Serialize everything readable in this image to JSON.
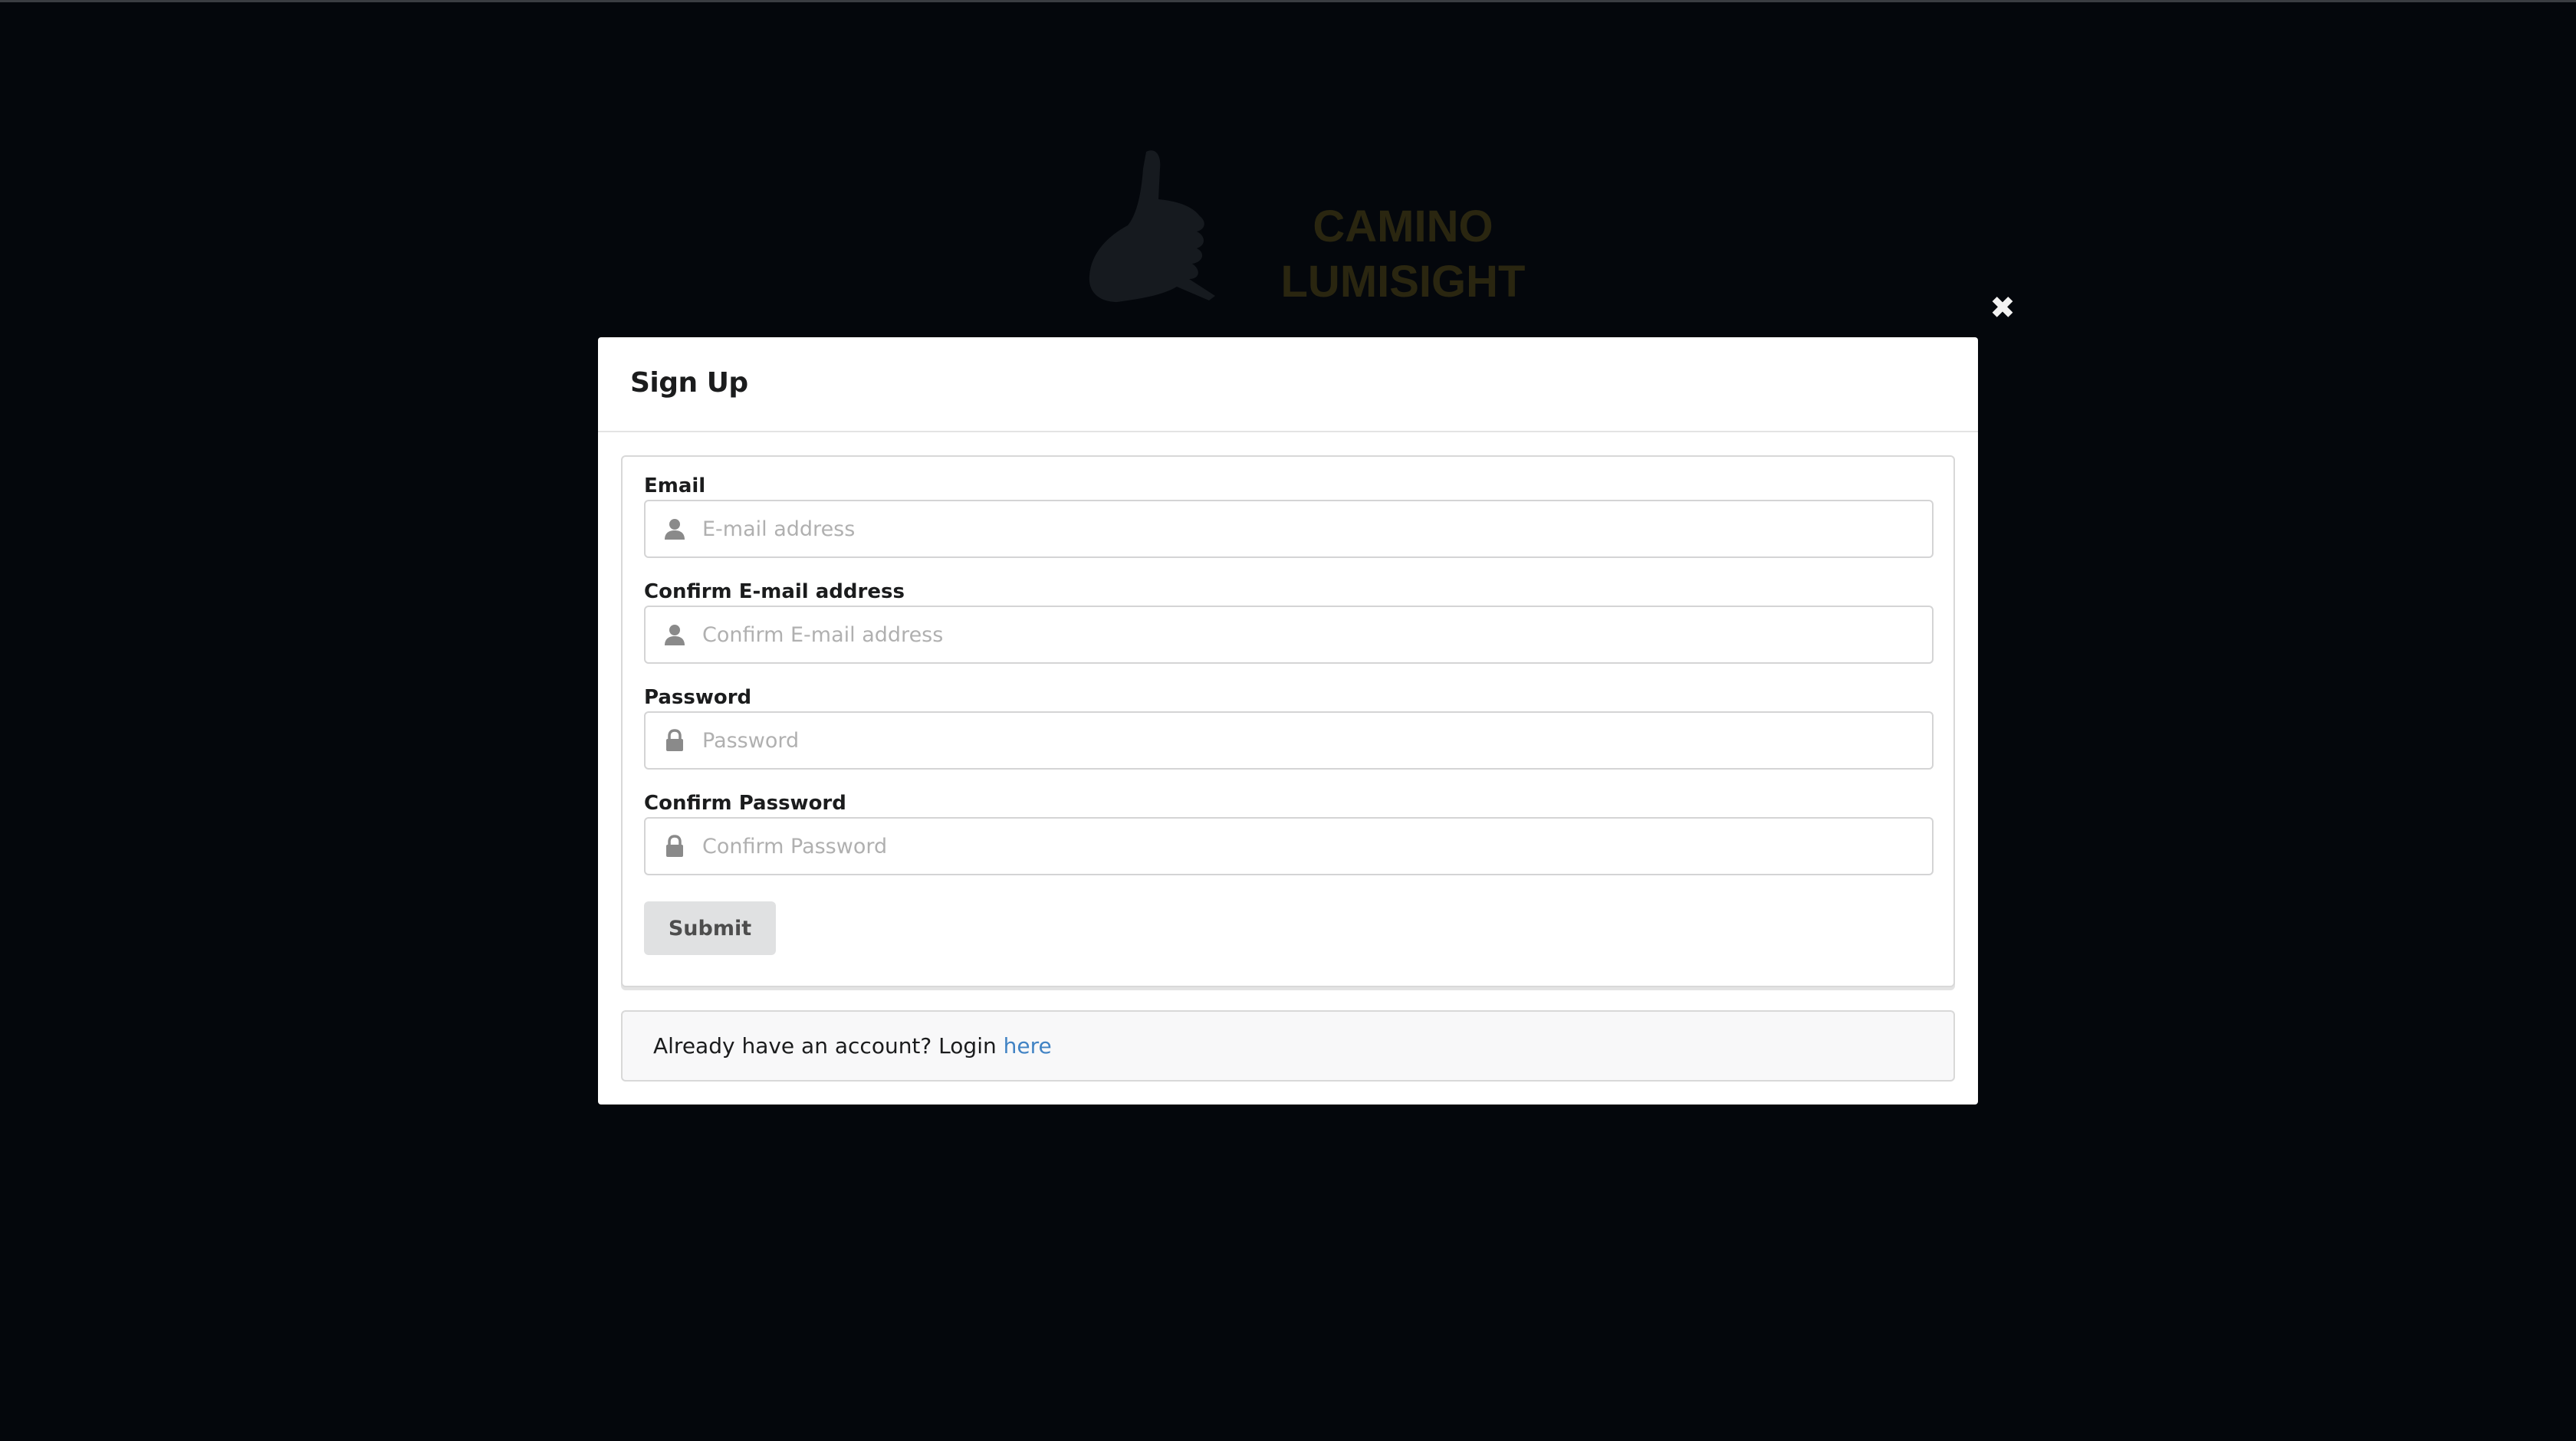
{
  "brand": {
    "line1": "CAMINO",
    "line2": "LUMISIGHT"
  },
  "modal": {
    "title": "Sign Up",
    "close_icon": "close-icon"
  },
  "form": {
    "fields": [
      {
        "label": "Email",
        "placeholder": "E-mail address",
        "value": "",
        "icon": "user-icon",
        "type": "text"
      },
      {
        "label": "Confirm E-mail address",
        "placeholder": "Confirm E-mail address",
        "value": "",
        "icon": "user-icon",
        "type": "text"
      },
      {
        "label": "Password",
        "placeholder": "Password",
        "value": "",
        "icon": "lock-icon",
        "type": "password"
      },
      {
        "label": "Confirm Password",
        "placeholder": "Confirm Password",
        "value": "",
        "icon": "lock-icon",
        "type": "password"
      }
    ],
    "submit_label": "Submit"
  },
  "footer": {
    "text": "Already have an account? Login ",
    "link_text": "here"
  },
  "colors": {
    "overlay": "#04070c",
    "link": "#4183c4",
    "button_bg": "#e0e1e2",
    "brand_text": "#2a2610"
  }
}
